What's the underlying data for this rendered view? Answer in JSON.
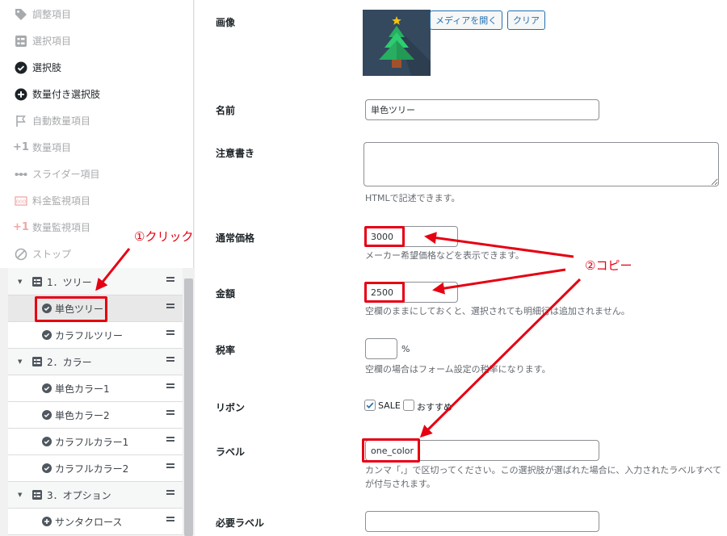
{
  "palette": [
    {
      "label": "調整項目",
      "icon": "tag-icon",
      "enabled": false
    },
    {
      "label": "選択項目",
      "icon": "list-select-icon",
      "enabled": false
    },
    {
      "label": "選択肢",
      "icon": "check-circle-icon",
      "enabled": true
    },
    {
      "label": "数量付き選択肢",
      "icon": "plus-circle-icon",
      "enabled": true
    },
    {
      "label": "自動数量項目",
      "icon": "flag-icon",
      "enabled": false
    },
    {
      "label": "数量項目",
      "icon": "plus-one-icon",
      "enabled": false
    },
    {
      "label": "スライダー項目",
      "icon": "slider-icon",
      "enabled": false
    },
    {
      "label": "料金監視項目",
      "icon": "price-monitor-icon",
      "enabled": false
    },
    {
      "label": "数量監視項目",
      "icon": "plus-one-icon",
      "enabled": false
    },
    {
      "label": "ストップ",
      "icon": "stop-icon",
      "enabled": false
    }
  ],
  "tree": [
    {
      "label": "1．ツリー",
      "type": "group"
    },
    {
      "label": "単色ツリー",
      "type": "item",
      "selected": true
    },
    {
      "label": "カラフルツリー",
      "type": "item"
    },
    {
      "label": "2．カラー",
      "type": "group"
    },
    {
      "label": "単色カラー1",
      "type": "item"
    },
    {
      "label": "単色カラー2",
      "type": "item"
    },
    {
      "label": "カラフルカラー1",
      "type": "item"
    },
    {
      "label": "カラフルカラー2",
      "type": "item"
    },
    {
      "label": "3．オプション",
      "type": "group"
    },
    {
      "label": "サンタクロース",
      "type": "item",
      "icon": "plus"
    }
  ],
  "form": {
    "image_label": "画像",
    "open_media_label": "メディアを開く",
    "clear_label": "クリア",
    "name_label": "名前",
    "name_value": "単色ツリー",
    "notes_label": "注意書き",
    "notes_help": "HTMLで記述できます。",
    "regular_price_label": "通常価格",
    "regular_price_value": "3000",
    "regular_price_help": "メーカー希望価格などを表示できます。",
    "price_label": "金額",
    "price_value": "2500",
    "price_help": "空欄のままにしておくと、選択されても明細行は追加されません。",
    "tax_label": "税率",
    "tax_unit": "%",
    "tax_help": "空欄の場合はフォーム設定の税率になります。",
    "ribbon_label": "リボン",
    "ribbon_sale": "SALE",
    "ribbon_recommend": "おすすめ",
    "label_label": "ラベル",
    "label_value": "one_color",
    "label_help": "カンマ「,」で区切ってください。この選択肢が選ばれた場合に、入力されたラベルすべてが付与されます。",
    "required_label_label": "必要ラベル"
  },
  "annotations": {
    "click": "①クリック",
    "copy": "②コピー"
  },
  "colors": {
    "accent": "#2271b1",
    "annotation": "#e60012"
  }
}
